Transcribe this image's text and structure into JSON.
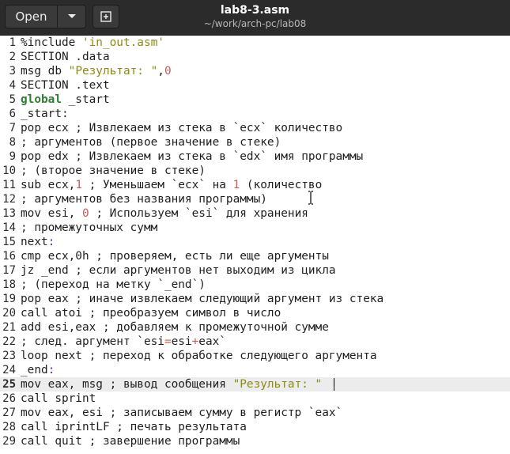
{
  "header": {
    "open_label": "Open",
    "file_title": "lab8-3.asm",
    "file_path": "~/work/arch-pc/lab08"
  },
  "icons": {
    "menu": "chevron-down-icon",
    "new_document": "new-document-icon"
  },
  "editor": {
    "current_line": 25,
    "lines": [
      {
        "n": "1",
        "segs": [
          {
            "t": "%include ",
            "c": ""
          },
          {
            "t": "'in_out.asm'",
            "c": "str"
          }
        ]
      },
      {
        "n": "2",
        "segs": [
          {
            "t": "SECTION .data",
            "c": ""
          }
        ]
      },
      {
        "n": "3",
        "segs": [
          {
            "t": "msg db ",
            "c": ""
          },
          {
            "t": "\"Результат: \"",
            "c": "str"
          },
          {
            "t": ",",
            "c": ""
          },
          {
            "t": "0",
            "c": "num"
          }
        ]
      },
      {
        "n": "4",
        "segs": [
          {
            "t": "SECTION .text",
            "c": ""
          }
        ]
      },
      {
        "n": "5",
        "segs": [
          {
            "t": "global",
            "c": "kw"
          },
          {
            "t": " _start",
            "c": ""
          }
        ]
      },
      {
        "n": "6",
        "segs": [
          {
            "t": "_start:",
            "c": ""
          }
        ]
      },
      {
        "n": "7",
        "segs": [
          {
            "t": "pop ecx ; Извлекаем из стека в `ecx` количество",
            "c": ""
          }
        ]
      },
      {
        "n": "8",
        "segs": [
          {
            "t": "; аргументов (первое значение в стеке)",
            "c": ""
          }
        ]
      },
      {
        "n": "9",
        "segs": [
          {
            "t": "pop edx ; Извлекаем из стека в `edx` имя программы",
            "c": ""
          }
        ]
      },
      {
        "n": "10",
        "segs": [
          {
            "t": "; (второе значение в стеке)",
            "c": ""
          }
        ]
      },
      {
        "n": "11",
        "segs": [
          {
            "t": "sub ecx,",
            "c": ""
          },
          {
            "t": "1",
            "c": "num"
          },
          {
            "t": " ; Уменьшаем `ecx` на ",
            "c": ""
          },
          {
            "t": "1",
            "c": "num"
          },
          {
            "t": " (количество",
            "c": ""
          }
        ]
      },
      {
        "n": "12",
        "segs": [
          {
            "t": "; аргументов без названия программы)",
            "c": ""
          }
        ]
      },
      {
        "n": "13",
        "segs": [
          {
            "t": "mov esi, ",
            "c": ""
          },
          {
            "t": "0",
            "c": "num"
          },
          {
            "t": " ; Используем `esi` для хранения",
            "c": ""
          }
        ]
      },
      {
        "n": "14",
        "segs": [
          {
            "t": "; промежуточных сумм",
            "c": ""
          }
        ]
      },
      {
        "n": "15",
        "segs": [
          {
            "t": "next",
            "c": ""
          },
          {
            "t": ":",
            "c": "lbl"
          }
        ]
      },
      {
        "n": "16",
        "segs": [
          {
            "t": "cmp ecx,0h ; проверяем, есть ли еще аргументы",
            "c": ""
          }
        ]
      },
      {
        "n": "17",
        "segs": [
          {
            "t": "jz _end ; если аргументов нет выходим из цикла",
            "c": ""
          }
        ]
      },
      {
        "n": "18",
        "segs": [
          {
            "t": "; (переход на метку `_end`)",
            "c": ""
          }
        ]
      },
      {
        "n": "19",
        "segs": [
          {
            "t": "pop eax ; иначе извлекаем следующий аргумент из стека",
            "c": ""
          }
        ]
      },
      {
        "n": "20",
        "segs": [
          {
            "t": "call atoi ; преобразуем символ в число",
            "c": ""
          }
        ]
      },
      {
        "n": "21",
        "segs": [
          {
            "t": "add esi,eax ; добавляем к промежуточной сумме",
            "c": ""
          }
        ]
      },
      {
        "n": "22",
        "segs": [
          {
            "t": "; след. аргумент `esi",
            "c": ""
          },
          {
            "t": "=",
            "c": "num"
          },
          {
            "t": "esi",
            "c": ""
          },
          {
            "t": "+",
            "c": "num"
          },
          {
            "t": "eax`",
            "c": ""
          }
        ]
      },
      {
        "n": "23",
        "segs": [
          {
            "t": "loop next ; переход к обработке следующего аргумента",
            "c": ""
          }
        ]
      },
      {
        "n": "24",
        "segs": [
          {
            "t": "_end",
            "c": ""
          },
          {
            "t": ":",
            "c": "lbl"
          }
        ]
      },
      {
        "n": "25",
        "segs": [
          {
            "t": "mov eax, msg ; вывод сообщения ",
            "c": ""
          },
          {
            "t": "\"Результат: \"",
            "c": "str"
          }
        ]
      },
      {
        "n": "26",
        "segs": [
          {
            "t": "call sprint",
            "c": ""
          }
        ]
      },
      {
        "n": "27",
        "segs": [
          {
            "t": "mov eax, esi ; записываем сумму в регистр `eax`",
            "c": ""
          }
        ]
      },
      {
        "n": "28",
        "segs": [
          {
            "t": "call iprintLF ; печать результата",
            "c": ""
          }
        ]
      },
      {
        "n": "29",
        "segs": [
          {
            "t": "call quit ; завершение программы",
            "c": ""
          }
        ]
      }
    ]
  }
}
